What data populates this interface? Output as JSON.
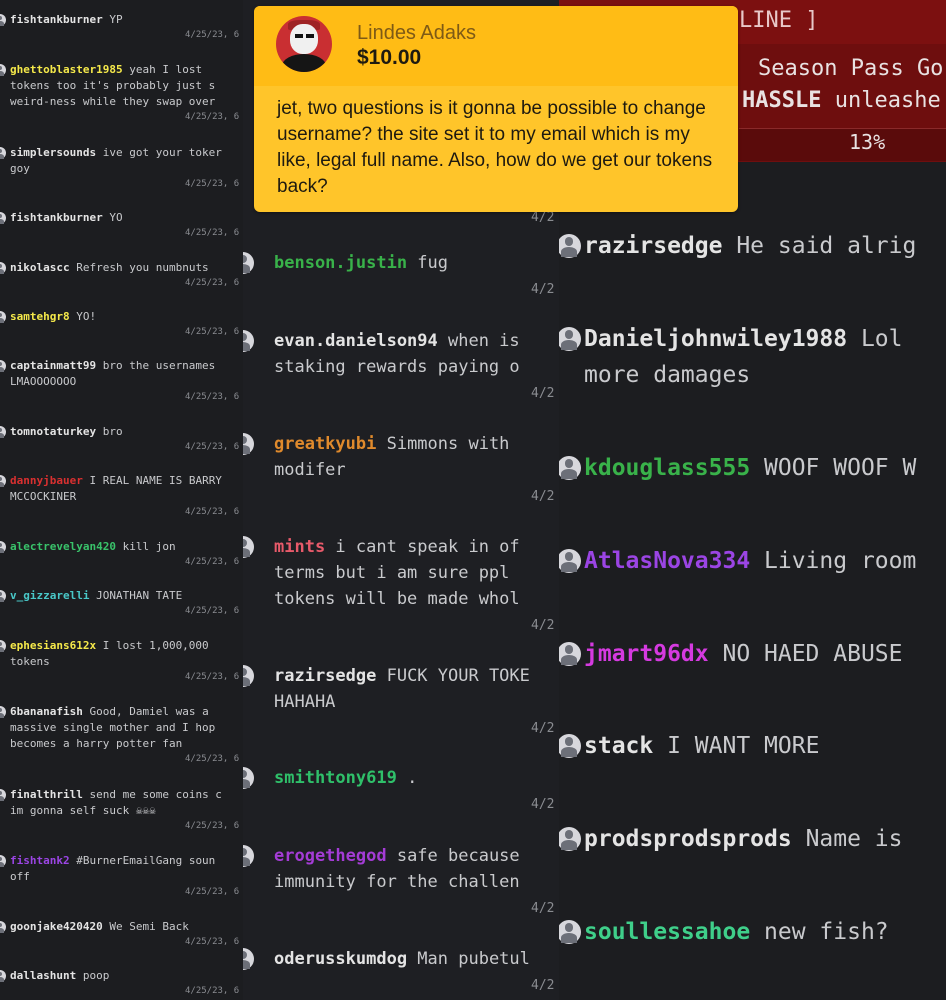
{
  "panel1": {
    "messages": [
      {
        "user": "fishtankburner",
        "user_color": "#e4e4e4",
        "lines": [
          "YP"
        ],
        "time": "4/25/23, 6"
      },
      {
        "user": "ghettoblaster1985",
        "user_color": "#f5e94a",
        "lines": [
          "yeah I lost",
          "tokens too it's probably just s",
          "weird-ness while they swap over"
        ],
        "time": "4/25/23, 6"
      },
      {
        "user": "simplersounds",
        "user_color": "#e4e4e4",
        "lines": [
          "ive got your toker",
          "goy"
        ],
        "time": "4/25/23, 6"
      },
      {
        "user": "fishtankburner",
        "user_color": "#e4e4e4",
        "lines": [
          "YO"
        ],
        "time": "4/25/23, 6"
      },
      {
        "user": "nikolascc",
        "user_color": "#e4e4e4",
        "lines": [
          "Refresh you numbnuts"
        ],
        "time": "4/25/23, 6"
      },
      {
        "user": "samtehgr8",
        "user_color": "#f5e94a",
        "lines": [
          "YO!"
        ],
        "time": "4/25/23, 6"
      },
      {
        "user": "captainmatt99",
        "user_color": "#e4e4e4",
        "lines": [
          "bro the usernames",
          "LMAOOOOOOO"
        ],
        "time": "4/25/23, 6"
      },
      {
        "user": "tomnotaturkey",
        "user_color": "#e4e4e4",
        "lines": [
          "bro"
        ],
        "time": "4/25/23, 6"
      },
      {
        "user": "dannyjbauer",
        "user_color": "#d93030",
        "lines": [
          "I REAL NAME IS BARRY",
          "MCCOCKINER"
        ],
        "time": "4/25/23, 6"
      },
      {
        "user": "alectrevelyan420",
        "user_color": "#39c26a",
        "lines": [
          "kill jon"
        ],
        "time": "4/25/23, 6"
      },
      {
        "user": "v_gizzarelli",
        "user_color": "#49c8c8",
        "lines": [
          "JONATHAN TATE"
        ],
        "time": "4/25/23, 6"
      },
      {
        "user": "ephesians612x",
        "user_color": "#f5e94a",
        "lines": [
          "I lost 1,000,000",
          "tokens"
        ],
        "time": "4/25/23, 6"
      },
      {
        "user": "6bananafish",
        "user_color": "#e4e4e4",
        "lines": [
          "Good, Damiel was a",
          "massive single mother and I hop",
          "becomes a harry potter fan"
        ],
        "time": "4/25/23, 6"
      },
      {
        "user": "finalthrill",
        "user_color": "#e4e4e4",
        "lines": [
          "send me some coins c",
          "im gonna self suck ☠☠☠"
        ],
        "time": "4/25/23, 6"
      },
      {
        "user": "fishtank2",
        "user_color": "#9b45e4",
        "lines": [
          "#BurnerEmailGang soun",
          "off"
        ],
        "time": "4/25/23, 6"
      },
      {
        "user": "goonjake420420",
        "user_color": "#e4e4e4",
        "lines": [
          "We Semi Back"
        ],
        "time": "4/25/23, 6"
      },
      {
        "user": "dallashunt",
        "user_color": "#e4e4e4",
        "lines": [
          "poop"
        ],
        "time": "4/25/23, 6"
      }
    ]
  },
  "panel2": {
    "messages": [
      {
        "user": "benson.justin",
        "user_color": "#39b24a",
        "lines": [
          "fug"
        ],
        "time": "4/2"
      },
      {
        "user": "evan.danielson94",
        "user_color": "#e4e4e4",
        "lines": [
          "when is",
          "staking rewards paying o"
        ],
        "time": "4/2"
      },
      {
        "user": "greatkyubi",
        "user_color": "#e08a2c",
        "lines": [
          "Simmons with",
          "modifer"
        ],
        "time": "4/2"
      },
      {
        "user": "mints",
        "user_color": "#e85a6a",
        "lines": [
          "i cant speak in of",
          "terms but i am sure ppl",
          "tokens will be made whol"
        ],
        "time": "4/2"
      },
      {
        "user": "razirsedge",
        "user_color": "#e4e4e4",
        "lines": [
          "FUCK YOUR TOKE",
          "HAHAHA"
        ],
        "time": "4/2"
      },
      {
        "user": "smithtony619",
        "user_color": "#2fc06a",
        "lines": [
          "."
        ],
        "time": "4/2"
      },
      {
        "user": "erogethegod",
        "user_color": "#a43cd6",
        "lines": [
          "safe because",
          "immunity for the challen"
        ],
        "time": "4/2"
      },
      {
        "user": "oderusskumdog",
        "user_color": "#e4e4e4",
        "lines": [
          "Man pubetul"
        ],
        "time": "4/2"
      }
    ],
    "top_time": "4/2"
  },
  "panel3": {
    "banner": {
      "title": "LINE ]",
      "line1": "Season Pass Go",
      "line2_bold": "HASSLE",
      "line2_rest": " unleashe",
      "progress": "13%"
    },
    "messages": [
      {
        "user": "razirsedge",
        "user_color": "#e4e4e4",
        "lines": [
          "He said alrig"
        ]
      },
      {
        "user": "Danieljohnwiley1988",
        "user_color": "#e4e4e4",
        "lines": [
          "Lol",
          "more damages"
        ]
      },
      {
        "user": "kdouglass555",
        "user_color": "#39b24a",
        "lines": [
          "WOOF WOOF W"
        ]
      },
      {
        "user": "AtlasNova334",
        "user_color": "#9b45e4",
        "lines": [
          "Living room"
        ]
      },
      {
        "user": "jmart96dx",
        "user_color": "#d53ae0",
        "lines": [
          "NO HAED ABUSE"
        ]
      },
      {
        "user": "stack",
        "user_color": "#e4e4e4",
        "lines": [
          "I WANT MORE"
        ]
      },
      {
        "user": "prodsprodsprods",
        "user_color": "#e4e4e4",
        "lines": [
          "Name is"
        ]
      },
      {
        "user": "soullessahoe",
        "user_color": "#3fcf8a",
        "lines": [
          "new fish?"
        ]
      }
    ]
  },
  "donation": {
    "name": "Lindes Adaks",
    "amount": "$10.00",
    "message": "jet, two questions is it gonna be possible to change username? the site set it to my email which is my like, legal full name. Also, how do we get our tokens back?"
  }
}
